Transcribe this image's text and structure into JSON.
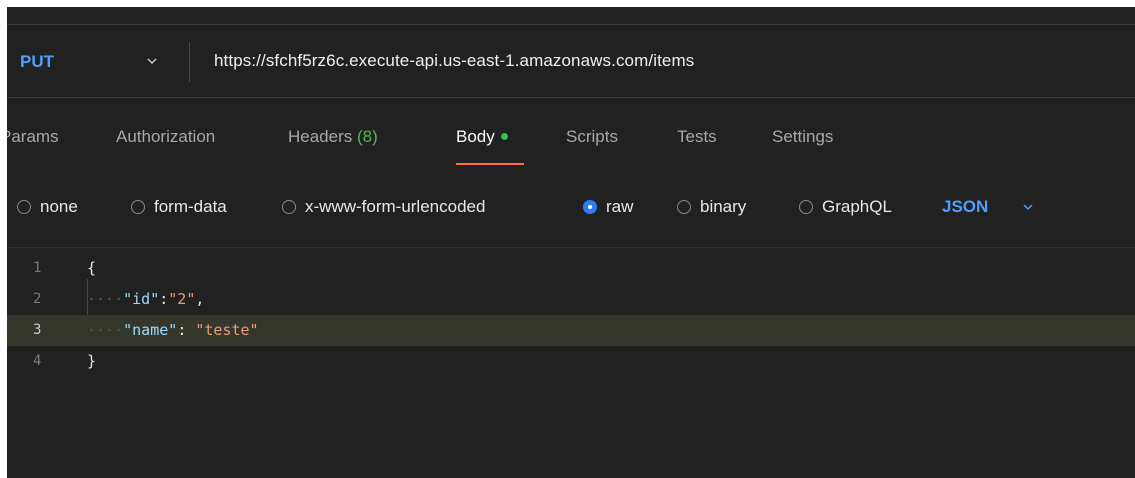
{
  "request": {
    "method": "PUT",
    "url": "https://sfchf5rz6c.execute-api.us-east-1.amazonaws.com/items"
  },
  "tabs": [
    {
      "label": "Params"
    },
    {
      "label": "Authorization"
    },
    {
      "label": "Headers",
      "count": "(8)"
    },
    {
      "label": "Body"
    },
    {
      "label": "Scripts"
    },
    {
      "label": "Tests"
    },
    {
      "label": "Settings"
    }
  ],
  "body_types": [
    {
      "label": "none",
      "checked": false
    },
    {
      "label": "form-data",
      "checked": false
    },
    {
      "label": "x-www-form-urlencoded",
      "checked": false
    },
    {
      "label": "raw",
      "checked": true
    },
    {
      "label": "binary",
      "checked": false
    },
    {
      "label": "GraphQL",
      "checked": false
    }
  ],
  "language": "JSON",
  "editor": {
    "lines": [
      {
        "num": "1",
        "open": "{"
      },
      {
        "num": "2",
        "key": "\"id\"",
        "sep": ":",
        "value": "\"2\"",
        "trail": ","
      },
      {
        "num": "3",
        "key": "\"name\"",
        "sep": ": ",
        "value": "\"teste\"",
        "trail": ""
      },
      {
        "num": "4",
        "close": "}"
      }
    ]
  },
  "colors": {
    "background": "#212121",
    "accent_blue": "#4f9fff",
    "active_tab_underline": "#ff6c37",
    "body_dot": "#35c05a"
  }
}
